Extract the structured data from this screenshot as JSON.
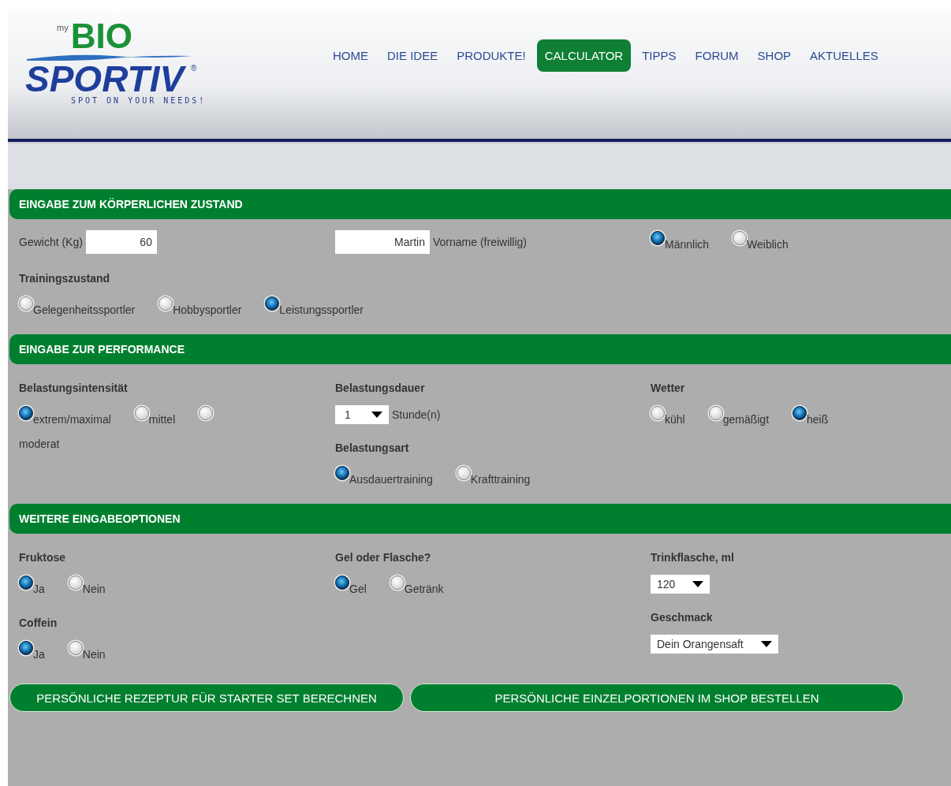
{
  "logo": {
    "prefix": "my",
    "word1": "BIO",
    "word2": "SPORTIV",
    "mark": "®",
    "tagline": "SPOT ON YOUR NEEDS!"
  },
  "nav": [
    {
      "label": "HOME",
      "selected": false
    },
    {
      "label": "DIE IDEE",
      "selected": false
    },
    {
      "label": "PRODUKTE!",
      "selected": false
    },
    {
      "label": "CALCULATOR",
      "selected": true
    },
    {
      "label": "TIPPS",
      "selected": false
    },
    {
      "label": "FORUM",
      "selected": false
    },
    {
      "label": "SHOP",
      "selected": false
    },
    {
      "label": "AKTUELLES",
      "selected": false
    }
  ],
  "sections": [
    {
      "title": "EINGABE ZUM KÖRPERLICHEN ZUSTAND",
      "rows": [
        {
          "cells": [
            [
              {
                "kind": "input",
                "label": "Gewicht (Kg)",
                "value": "60"
              }
            ],
            [
              {
                "kind": "input",
                "value": "Martin",
                "suffix": "Vorname (freiwillig)"
              }
            ],
            [
              {
                "kind": "radios",
                "options": [
                  {
                    "label": "Männlich",
                    "selected": true
                  },
                  {
                    "label": "Weiblich",
                    "selected": false
                  }
                ]
              }
            ]
          ]
        },
        {
          "cells": [
            [
              {
                "kind": "heading",
                "text": "Trainingszustand"
              },
              {
                "kind": "radios",
                "options": [
                  {
                    "label": "Gelegenheitssportler",
                    "selected": false
                  },
                  {
                    "label": "Hobbysportler",
                    "selected": false
                  },
                  {
                    "label": "Leistungssportler",
                    "selected": true
                  }
                ]
              }
            ]
          ]
        }
      ]
    },
    {
      "title": "EINGABE ZUR PERFORMANCE",
      "rows": [
        {
          "cells": [
            [
              {
                "kind": "heading",
                "text": "Belastungsintensität"
              },
              {
                "kind": "radios",
                "options": [
                  {
                    "label": "extrem/maximal",
                    "selected": true
                  },
                  {
                    "label": "mittel",
                    "selected": false
                  },
                  {
                    "label": "moderat",
                    "selected": false
                  }
                ]
              }
            ],
            [
              {
                "kind": "heading",
                "text": "Belastungsdauer"
              },
              {
                "kind": "select",
                "value": "1",
                "suffix": "Stunde(n)"
              },
              {
                "kind": "heading",
                "text": "Belastungsart"
              },
              {
                "kind": "radios",
                "options": [
                  {
                    "label": "Ausdauertraining",
                    "selected": true
                  },
                  {
                    "label": "Krafttraining",
                    "selected": false
                  }
                ]
              }
            ],
            [
              {
                "kind": "heading",
                "text": "Wetter"
              },
              {
                "kind": "radios",
                "options": [
                  {
                    "label": "kühl",
                    "selected": false
                  },
                  {
                    "label": "gemäßigt",
                    "selected": false
                  },
                  {
                    "label": "heiß",
                    "selected": true
                  }
                ]
              }
            ]
          ]
        }
      ]
    },
    {
      "title": "WEITERE EINGABEOPTIONEN",
      "rows": [
        {
          "cells": [
            [
              {
                "kind": "heading",
                "text": "Fruktose"
              },
              {
                "kind": "radios",
                "options": [
                  {
                    "label": "Ja",
                    "selected": true
                  },
                  {
                    "label": "Nein",
                    "selected": false
                  }
                ]
              },
              {
                "kind": "heading",
                "text": "Coffein"
              },
              {
                "kind": "radios",
                "options": [
                  {
                    "label": "Ja",
                    "selected": true
                  },
                  {
                    "label": "Nein",
                    "selected": false
                  }
                ]
              }
            ],
            [
              {
                "kind": "heading",
                "text": "Gel oder Flasche?"
              },
              {
                "kind": "radios",
                "options": [
                  {
                    "label": "Gel",
                    "selected": true
                  },
                  {
                    "label": "Getränk",
                    "selected": false
                  }
                ]
              }
            ],
            [
              {
                "kind": "heading",
                "text": "Trinkflasche, ml"
              },
              {
                "kind": "select",
                "value": "120"
              },
              {
                "kind": "heading",
                "text": "Geschmack"
              },
              {
                "kind": "select",
                "value": "Dein Orangensaft"
              }
            ]
          ]
        }
      ]
    }
  ],
  "buttons": [
    "PERSÖNLICHE REZEPTUR FÜR STARTER SET BERECHNEN",
    "PERSÖNLICHE EINZELPORTIONEN IM SHOP BESTELLEN"
  ]
}
